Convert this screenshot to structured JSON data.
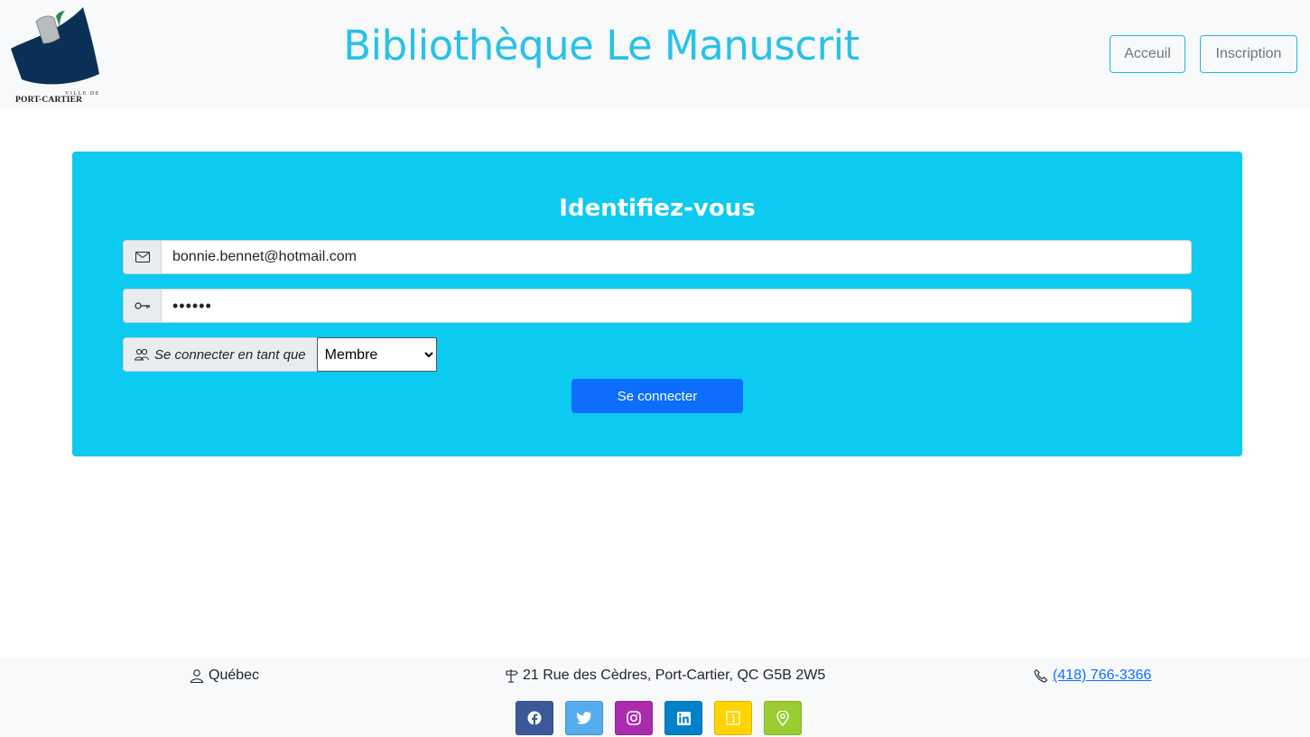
{
  "header": {
    "logo": {
      "line1": "VILLE DE",
      "line2": "PORT-CARTIER"
    },
    "title": "Bibliothèque Le Manuscrit",
    "nav": {
      "home_label": "Acceuil",
      "signup_label": "Inscription"
    }
  },
  "login": {
    "heading": "Identifiez-vous",
    "email_value": "bonnie.bennet@hotmail.com",
    "password_value": "••••••",
    "role_label": "Se connecter en tant que",
    "role_selected": "Membre",
    "submit_label": "Se connecter",
    "icons": {
      "email": "envelope-icon",
      "password": "key-icon",
      "role": "people-icon"
    }
  },
  "footer": {
    "region": "Québec",
    "address": "21 Rue des Cèdres, Port-Cartier, QC G5B 2W5",
    "phone": "(418) 766-3366",
    "icons": {
      "region": "person-icon",
      "address": "signpost-icon",
      "phone": "telephone-icon"
    },
    "socials": [
      {
        "name": "facebook-icon",
        "color": "#3b5998"
      },
      {
        "name": "twitter-icon",
        "color": "#55acee"
      },
      {
        "name": "instagram-icon",
        "color": "#ac2bac"
      },
      {
        "name": "linkedin-icon",
        "color": "#0082ca"
      },
      {
        "name": "info-icon",
        "color": "#ffd400"
      },
      {
        "name": "map-pin-icon",
        "color": "#9acd32"
      }
    ]
  },
  "colors": {
    "accent": "#0dcaf0",
    "title": "#28c1e8",
    "primary_button": "#0d6efd",
    "header_bg": "#f8f9fa"
  }
}
